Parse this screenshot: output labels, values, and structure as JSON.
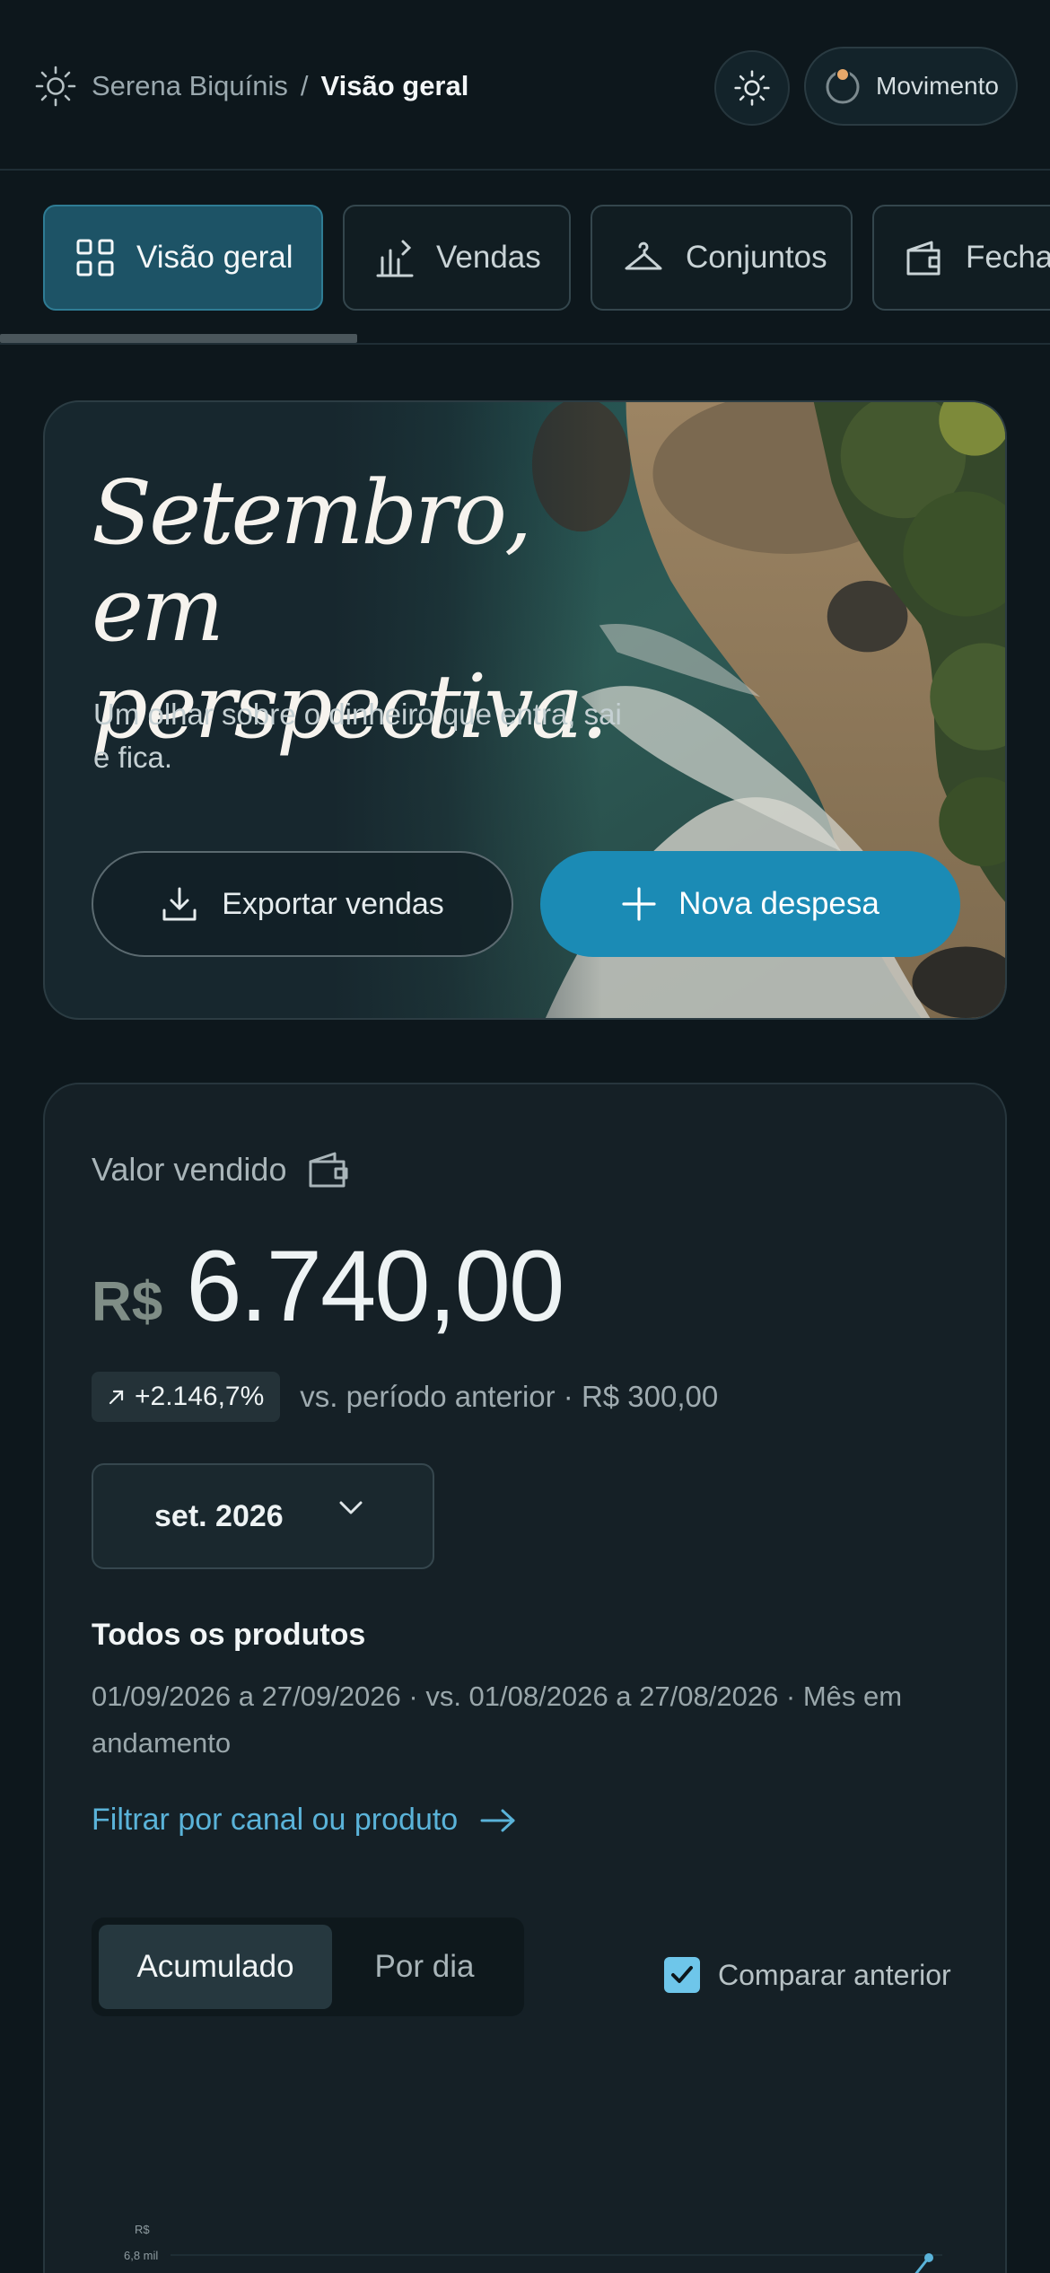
{
  "header": {
    "store_name": "Serena Biquínis",
    "separator": "/",
    "current_page": "Visão geral",
    "movement_label": "Movimento"
  },
  "tabs": [
    {
      "label": "Visão geral",
      "icon": "grid-icon",
      "active": true
    },
    {
      "label": "Vendas",
      "icon": "bar-chart-icon",
      "active": false
    },
    {
      "label": "Conjuntos",
      "icon": "hanger-icon",
      "active": false
    },
    {
      "label": "Fecha",
      "icon": "wallet-icon",
      "active": false
    }
  ],
  "hero": {
    "title": "Setembro, em perspectiva.",
    "subtitle": "Um olhar sobre o dinheiro que entra, sai e fica.",
    "export_label": "Exportar vendas",
    "new_expense_label": "Nova despesa"
  },
  "sales": {
    "label": "Valor vendido",
    "currency": "R$",
    "amount": "6.740,00",
    "delta": "+2.146,7%",
    "comparison": "vs. período anterior · R$ 300,00",
    "period": "set. 2026",
    "products_title": "Todos os produtos",
    "range": "01/09/2026 a 27/09/2026 · vs. 01/08/2026 a 27/08/2026 · Mês em andamento",
    "filter_link": "Filtrar por canal ou produto",
    "mode_cumulative": "Acumulado",
    "mode_daily": "Por dia",
    "compare_label": "Comparar anterior",
    "compare_checked": true
  },
  "chart_data": {
    "type": "line",
    "ylabel": "R$",
    "y_tick_labels": [
      "6,8 mil"
    ]
  },
  "colors": {
    "background": "#0d171c",
    "accent": "#1b8bb5",
    "active_tab": "#1d5366",
    "link": "#5ab3d9",
    "status_dot": "#e8a86a"
  }
}
